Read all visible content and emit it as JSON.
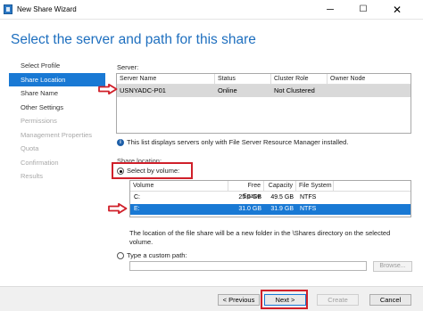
{
  "window": {
    "title": "New Share Wizard",
    "minimize_glyph": "─",
    "maximize_glyph": "☐",
    "close_glyph": "✕"
  },
  "page": {
    "heading": "Select the server and path for this share"
  },
  "nav": {
    "items": [
      {
        "label": "Select Profile",
        "state": "normal"
      },
      {
        "label": "Share Location",
        "state": "active"
      },
      {
        "label": "Share Name",
        "state": "normal"
      },
      {
        "label": "Other Settings",
        "state": "normal"
      },
      {
        "label": "Permissions",
        "state": "disabled"
      },
      {
        "label": "Management Properties",
        "state": "disabled"
      },
      {
        "label": "Quota",
        "state": "disabled"
      },
      {
        "label": "Confirmation",
        "state": "disabled"
      },
      {
        "label": "Results",
        "state": "disabled"
      }
    ]
  },
  "server_section": {
    "label": "Server:",
    "columns": [
      "Server Name",
      "Status",
      "Cluster Role",
      "Owner Node"
    ],
    "rows": [
      {
        "server_name": "USNYADC-P01",
        "status": "Online",
        "cluster_role": "Not Clustered",
        "owner_node": ""
      }
    ],
    "info_text": "This list displays servers only with File Server Resource Manager installed."
  },
  "share_location": {
    "label": "Share location:",
    "by_volume_label": "Select by volume:",
    "by_volume_selected": true,
    "volume_columns": [
      "Volume",
      "Free Space",
      "Capacity",
      "File System"
    ],
    "volumes": [
      {
        "volume": "C:",
        "free_space": "25.5 GB",
        "capacity": "49.5 GB",
        "file_system": "NTFS",
        "selected": false
      },
      {
        "volume": "E:",
        "free_space": "31.0 GB",
        "capacity": "31.9 GB",
        "file_system": "NTFS",
        "selected": true
      }
    ],
    "description": "The location of the file share will be a new folder in the \\Shares directory on the selected volume.",
    "custom_path_label": "Type a custom path:",
    "custom_path_selected": false,
    "custom_path_value": "",
    "browse_label": "Browse..."
  },
  "footer": {
    "previous_label": "< Previous",
    "next_label": "Next >",
    "create_label": "Create",
    "cancel_label": "Cancel"
  },
  "annotations": {
    "highlight_color": "#d0202a"
  },
  "colors": {
    "accent": "#1979d4",
    "heading": "#1e6fbf"
  }
}
